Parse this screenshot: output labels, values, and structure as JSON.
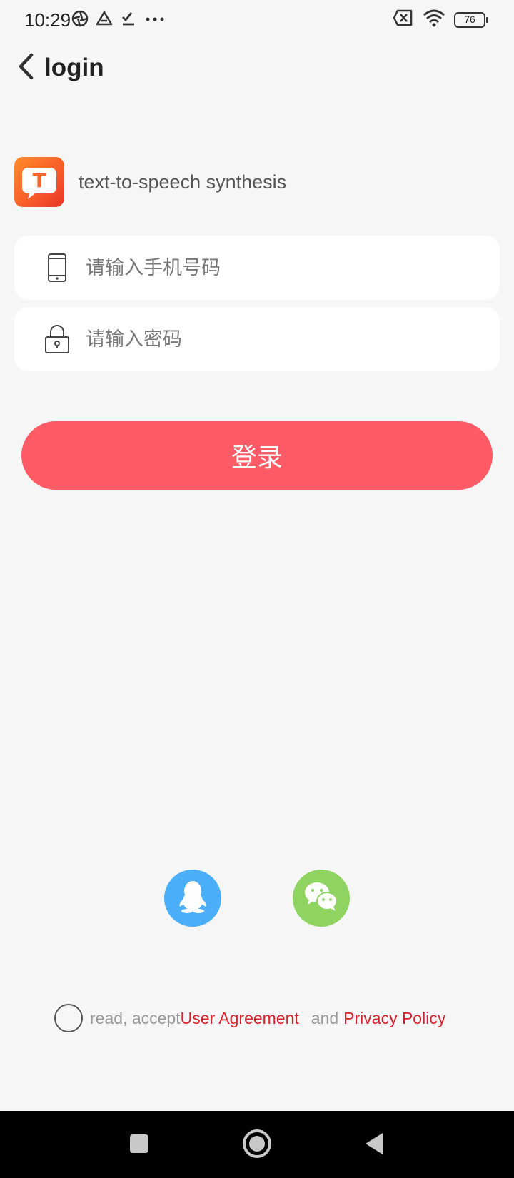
{
  "status_bar": {
    "time": "10:29",
    "battery_level": "76",
    "icons_left": [
      "aperture-icon",
      "drive-icon",
      "checkmark-icon",
      "more-dots-icon"
    ],
    "icons_right": [
      "no-sim-icon",
      "wifi-icon",
      "battery-icon"
    ]
  },
  "nav": {
    "title": "login",
    "back_icon": "chevron-left-icon"
  },
  "app": {
    "logo_letter": "T",
    "name": "text-to-speech synthesis"
  },
  "form": {
    "phone_placeholder": "请输入手机号码",
    "phone_value": "",
    "password_placeholder": "请输入密码",
    "password_value": "",
    "login_label": "登录"
  },
  "social": {
    "qq_icon": "qq-penguin-icon",
    "wechat_icon": "wechat-icon"
  },
  "agreement": {
    "prefix": "read, accept",
    "user_agreement": "User Agreement",
    "conjunction": "and",
    "privacy_policy": "Privacy Policy",
    "checked": false
  },
  "colors": {
    "accent": "#fe5b66",
    "link": "#d81f2c",
    "qq": "#4aaef8",
    "wechat": "#8fd461",
    "background": "#f6f6f6"
  }
}
